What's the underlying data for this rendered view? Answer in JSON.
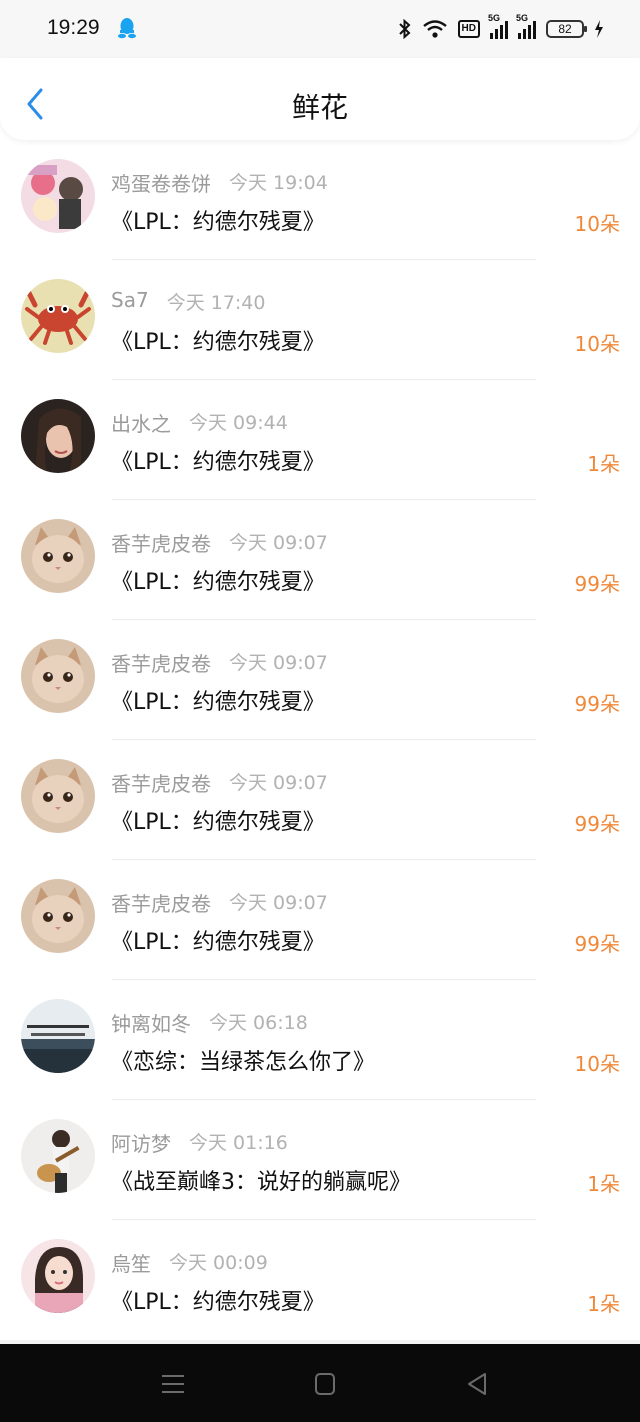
{
  "status": {
    "time": "19:29",
    "signal_1": "5G",
    "signal_2": "5G",
    "hd": "HD",
    "battery": "82"
  },
  "header": {
    "title": "鲜花"
  },
  "rows": [
    {
      "name": "鸡蛋卷卷饼",
      "time": "今天 19:04",
      "book": "《LPL：约德尔残夏》",
      "amount": "10朵"
    },
    {
      "name": "Sa7",
      "time": "今天 17:40",
      "book": "《LPL：约德尔残夏》",
      "amount": "10朵"
    },
    {
      "name": "出水之",
      "time": "今天 09:44",
      "book": "《LPL：约德尔残夏》",
      "amount": "1朵"
    },
    {
      "name": "香芋虎皮卷",
      "time": "今天 09:07",
      "book": "《LPL：约德尔残夏》",
      "amount": "99朵"
    },
    {
      "name": "香芋虎皮卷",
      "time": "今天 09:07",
      "book": "《LPL：约德尔残夏》",
      "amount": "99朵"
    },
    {
      "name": "香芋虎皮卷",
      "time": "今天 09:07",
      "book": "《LPL：约德尔残夏》",
      "amount": "99朵"
    },
    {
      "name": "香芋虎皮卷",
      "time": "今天 09:07",
      "book": "《LPL：约德尔残夏》",
      "amount": "99朵"
    },
    {
      "name": "钟离如冬",
      "time": "今天 06:18",
      "book": "《恋综：当绿茶怎么你了》",
      "amount": "10朵"
    },
    {
      "name": "阿访梦",
      "time": "今天 01:16",
      "book": "《战至巅峰3：说好的躺赢呢》",
      "amount": "1朵"
    },
    {
      "name": "烏笙",
      "time": "今天 00:09",
      "book": "《LPL：约德尔残夏》",
      "amount": "1朵"
    }
  ],
  "colors": {
    "accent": "#2a8de8",
    "amount": "#f0883a",
    "meta": "#9b9b9b"
  }
}
